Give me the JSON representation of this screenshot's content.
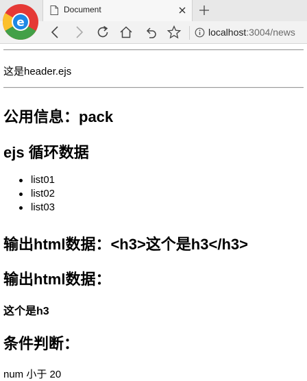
{
  "browser": {
    "tab_title": "Document",
    "url_host": "localhost",
    "url_rest": ":3004/news",
    "accent_red": "#e53935",
    "accent_yellow": "#fbc02d",
    "accent_green": "#43a047",
    "accent_blue": "#1e88e5"
  },
  "page": {
    "header_text": "这是header.ejs",
    "public_info": "公用信息：pack",
    "loop_title": "ejs 循环数据",
    "list_items": [
      "list01",
      "list02",
      "list03"
    ],
    "html_escaped": "输出html数据：<h3>这个是h3</h3>",
    "html_raw_title": "输出html数据：",
    "html_raw_h3": "这个是h3",
    "condition_title": "条件判断：",
    "condition_result": "num 小于 20"
  }
}
